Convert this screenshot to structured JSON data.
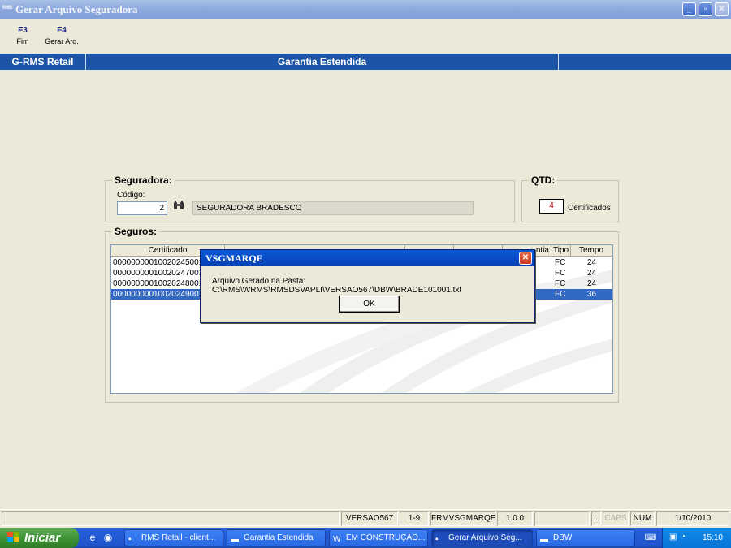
{
  "window": {
    "app_icon": "RMS",
    "title": "Gerar Arquivo Seguradora",
    "minimize_glyph": "_",
    "maximize_glyph": "▫",
    "close_glyph": "✕"
  },
  "toolbar": {
    "buttons": [
      {
        "key": "F3",
        "label": "Fim"
      },
      {
        "key": "F4",
        "label": "Gerar Arq."
      }
    ]
  },
  "module_bar": {
    "left": "G-RMS Retail",
    "center": "Garantia Estendida"
  },
  "seguradora": {
    "frame_title": "Seguradora:",
    "codigo_label": "Código:",
    "codigo_value": "2",
    "name_value": "SEGURADORA BRADESCO",
    "find_icon": "binoculars-icon"
  },
  "qtd": {
    "frame_title": "QTD:",
    "value": "4",
    "unit_label": "Certificados"
  },
  "seguros": {
    "frame_title": "Seguros:",
    "columns": [
      "Certificado",
      "ntia",
      "Tipo",
      "Tempo"
    ],
    "rows": [
      {
        "certificado": "00000000010020245001",
        "tipo": "FC",
        "tempo": "24",
        "selected": false
      },
      {
        "certificado": "00000000010020247001",
        "tipo": "FC",
        "tempo": "24",
        "selected": false
      },
      {
        "certificado": "00000000010020248001",
        "tipo": "FC",
        "tempo": "24",
        "selected": false
      },
      {
        "certificado": "00000000010020249001",
        "tipo": "FC",
        "tempo": "36",
        "selected": true
      }
    ]
  },
  "dialog": {
    "title": "VSGMARQE",
    "message": "Arquivo Gerado na Pasta: C:\\RMS\\WRMS\\RMSDSVAPLI\\VERSAO567\\DBW\\BRADE101001.txt",
    "ok_label": "OK",
    "close_glyph": "✕"
  },
  "statusbar": {
    "panels": [
      "VERSAO567",
      "1-9",
      "FRMVSGMARQE",
      "1.0.0",
      "L",
      "CAPS",
      "NUM",
      "1/10/2010"
    ]
  },
  "taskbar": {
    "start_label": "Iniciar",
    "items": [
      {
        "label": "RMS Retail - client...",
        "icon": "rms-icon"
      },
      {
        "label": "Garantia Estendida",
        "icon": "folder-icon"
      },
      {
        "label": "EM CONSTRUÇÃO...",
        "icon": "word-icon"
      },
      {
        "label": "Gerar Arquivo Seg...",
        "icon": "rms-icon",
        "active": true
      },
      {
        "label": "DBW",
        "icon": "folder-icon"
      }
    ],
    "clock": "15:10"
  }
}
